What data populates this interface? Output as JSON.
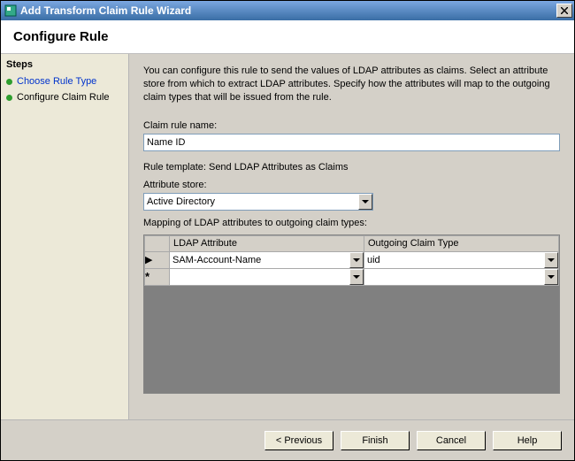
{
  "titlebar": {
    "title": "Add Transform Claim Rule Wizard"
  },
  "header": {
    "title": "Configure Rule"
  },
  "sidebar": {
    "title": "Steps",
    "items": [
      {
        "label": "Choose Rule Type",
        "active": true
      },
      {
        "label": "Configure Claim Rule",
        "active": false
      }
    ]
  },
  "main": {
    "description": "You can configure this rule to send the values of LDAP attributes as claims. Select an attribute store from which to extract LDAP attributes. Specify how the attributes will map to the outgoing claim types that will be issued from the rule.",
    "claim_rule_name_label": "Claim rule name:",
    "claim_rule_name_value": "Name ID",
    "rule_template_text": "Rule template: Send LDAP Attributes as Claims",
    "attribute_store_label": "Attribute store:",
    "attribute_store_value": "Active Directory",
    "mapping_label": "Mapping of LDAP attributes to outgoing claim types:",
    "grid": {
      "headers": [
        "LDAP Attribute",
        "Outgoing Claim Type"
      ],
      "rows": [
        {
          "marker": "▶",
          "ldap": "SAM-Account-Name",
          "claim": "uid"
        },
        {
          "marker": "*",
          "ldap": "",
          "claim": ""
        }
      ]
    }
  },
  "footer": {
    "previous": "< Previous",
    "finish": "Finish",
    "cancel": "Cancel",
    "help": "Help"
  }
}
